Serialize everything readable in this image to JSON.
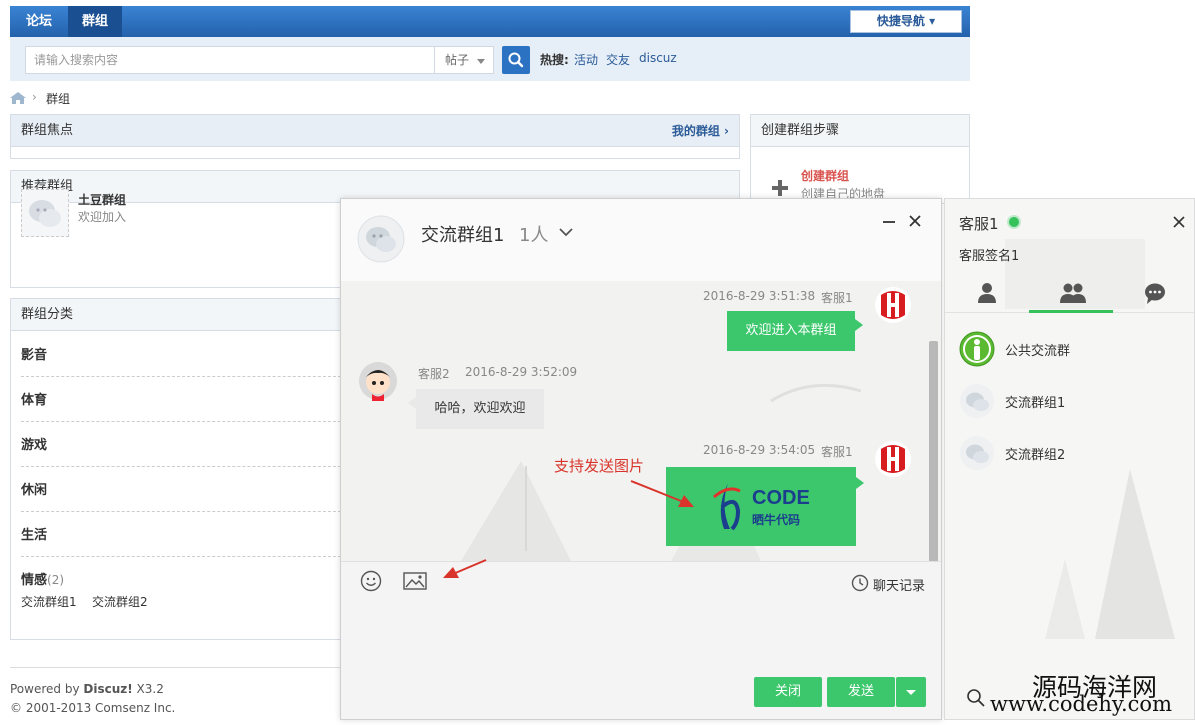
{
  "nav": {
    "tabs": [
      {
        "label": "论坛"
      },
      {
        "label": "群组"
      }
    ],
    "quick_nav": "快捷导航 ▾"
  },
  "search": {
    "placeholder": "请输入搜索内容",
    "type": "帖子",
    "hot_label": "热搜:",
    "hot_links": [
      "活动",
      "交友",
      "discuz"
    ]
  },
  "breadcrumb": {
    "current": "群组"
  },
  "focus": {
    "title": "群组焦点",
    "my_groups": "我的群组 ›"
  },
  "recommend": {
    "title": "推荐群组",
    "item": {
      "name": "土豆群组",
      "desc": "欢迎加入"
    }
  },
  "categories": {
    "title": "群组分类",
    "items": [
      "影音",
      "体育",
      "游戏",
      "休闲",
      "生活"
    ],
    "last": {
      "name": "情感",
      "count": "(2)",
      "subs": [
        "交流群组1",
        "交流群组2"
      ]
    }
  },
  "steps": {
    "title": "创建群组步骤",
    "step1_title": "创建群组",
    "step1_desc": "创建自己的地盘"
  },
  "footer": {
    "powered_prefix": "Powered by ",
    "powered_brand": "Discuz!",
    "powered_version": " X3.2",
    "copyright": "© 2001-2013 Comsenz Inc."
  },
  "chat": {
    "group_name": "交流群组1",
    "member_count": "1人",
    "messages": [
      {
        "sender": "客服1",
        "time": "2016-8-29 3:51:38",
        "text": "欢迎进入本群组",
        "side": "right"
      },
      {
        "sender": "客服2",
        "time": "2016-8-29 3:52:09",
        "text": "哈哈，欢迎欢迎",
        "side": "left"
      },
      {
        "sender": "客服1",
        "time": "2016-8-29 3:54:05",
        "image_brand": "CODE",
        "image_sub": "晒牛代码",
        "side": "right"
      }
    ],
    "annotation": "支持发送图片",
    "history": "聊天记录",
    "close_label": "关闭",
    "send_label": "发送"
  },
  "panel": {
    "name": "客服1",
    "signature": "客服签名1",
    "contacts": [
      "公共交流群",
      "交流群组1",
      "交流群组2"
    ]
  },
  "watermark": {
    "line1": "源码海洋网",
    "line2": "www.codehy.com"
  },
  "colors": {
    "brand_blue": "#2b72c2",
    "chat_green": "#3cc76d",
    "online": "#35c25a"
  }
}
